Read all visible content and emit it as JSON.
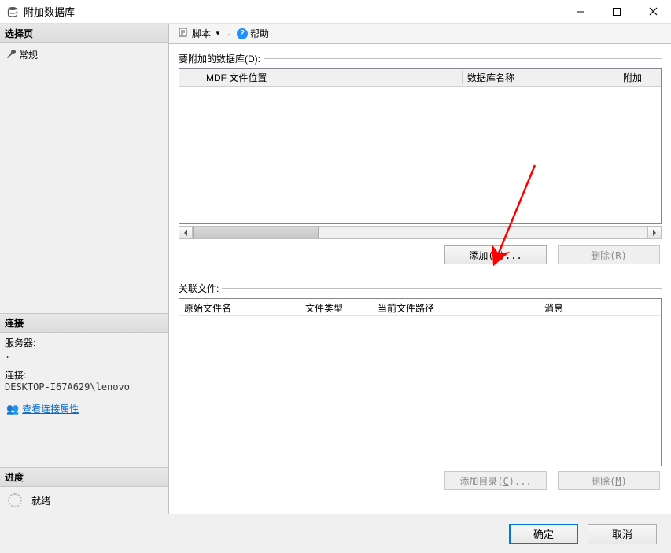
{
  "window": {
    "title": "附加数据库"
  },
  "sidebar": {
    "select_page_header": "选择页",
    "general_item": "常规",
    "connection_header": "连接",
    "server_label": "服务器:",
    "server_value": ".",
    "conn_label": "连接:",
    "conn_value": "DESKTOP-I67A629\\lenovo",
    "view_conn_props": "查看连接属性",
    "progress_header": "进度",
    "progress_status": "就绪"
  },
  "toolbar": {
    "script": "脚本",
    "help": "帮助"
  },
  "main": {
    "attach_group_label": "要附加的数据库(D):",
    "grid1_headers": {
      "mdf": "MDF 文件位置",
      "dbname": "数据库名称",
      "attach": "附加"
    },
    "add_btn": "添加(A)...",
    "remove_btn": "删除(R)",
    "assoc_group_label": "关联文件:",
    "grid2_headers": {
      "orig": "原始文件名",
      "type": "文件类型",
      "path": "当前文件路径",
      "msg": "消息"
    },
    "add_dir_btn": "添加目录(C)...",
    "remove2_btn": "删除(M)"
  },
  "footer": {
    "ok": "确定",
    "cancel": "取消"
  }
}
